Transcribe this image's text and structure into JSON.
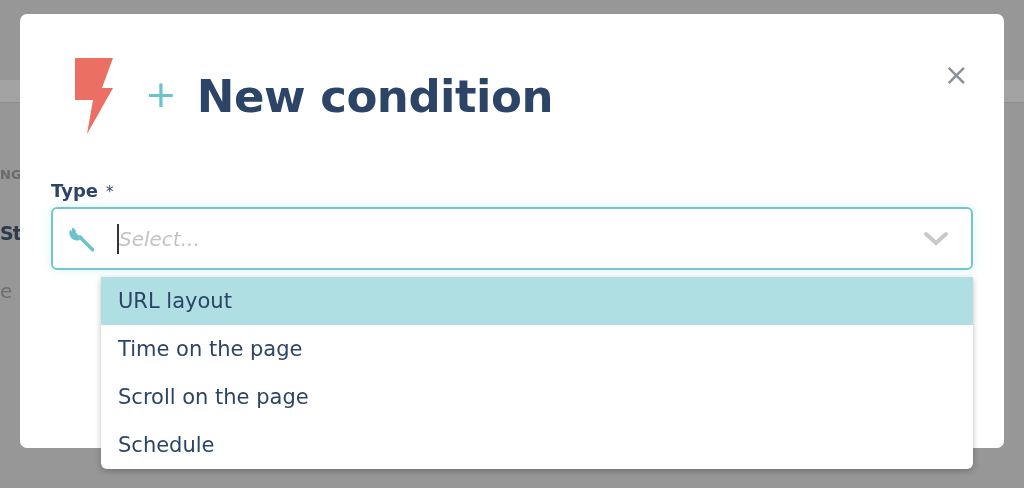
{
  "background": {
    "fragments": [
      {
        "text": "NG",
        "kind": "caption"
      },
      {
        "text": "St",
        "kind": "heading"
      },
      {
        "text": "e",
        "kind": "body"
      }
    ]
  },
  "dialog": {
    "title_prefix": "+",
    "title": "New condition",
    "close": "×",
    "field": {
      "label": "Type",
      "required_mark": "*",
      "placeholder": "Select..."
    },
    "options": [
      {
        "label": "URL layout",
        "selected": true
      },
      {
        "label": "Time on the page",
        "selected": false
      },
      {
        "label": "Scroll on the page",
        "selected": false
      },
      {
        "label": "Schedule",
        "selected": false
      }
    ]
  }
}
